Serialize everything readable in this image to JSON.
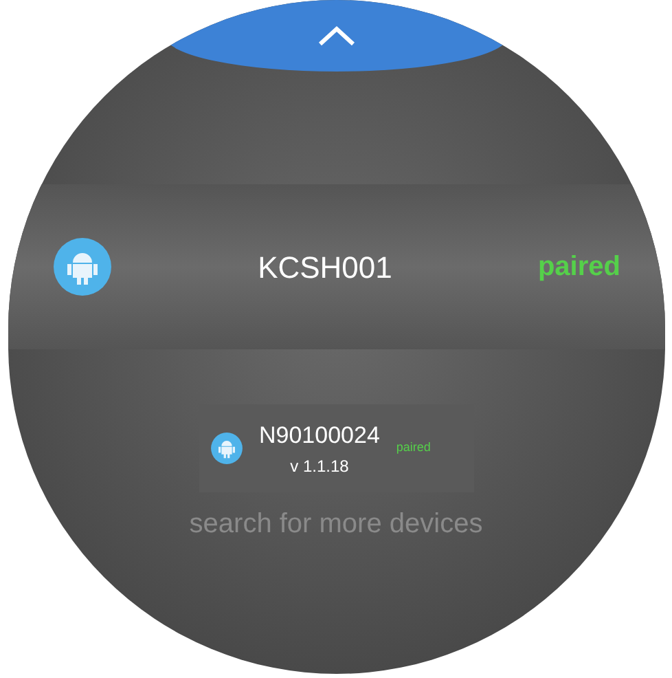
{
  "devices": [
    {
      "name": "KCSH001",
      "status": "paired",
      "selected": true
    },
    {
      "name": "N90100024",
      "status": "paired",
      "version": "v 1.1.18",
      "selected": false
    }
  ],
  "footer": {
    "link": "search for more devices"
  }
}
